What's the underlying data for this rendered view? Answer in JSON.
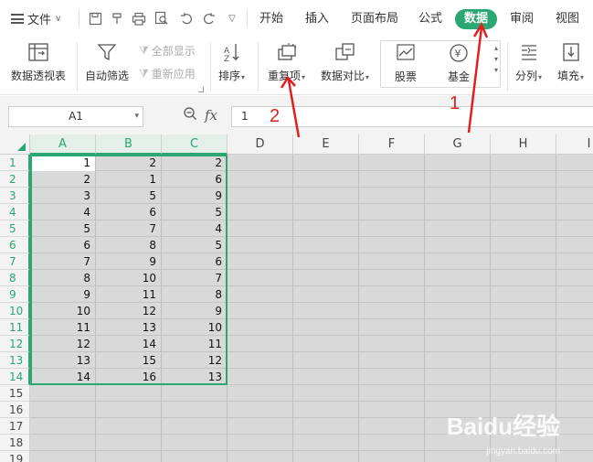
{
  "menu": {
    "file_label": "文件",
    "tabs": [
      "开始",
      "插入",
      "页面布局",
      "公式",
      "数据",
      "审阅",
      "视图"
    ],
    "active_tab": "数据",
    "accent": "#2aa772"
  },
  "ribbon": {
    "pivot": "数据透视表",
    "autofilter": "自动筛选",
    "show_all": "全部显示",
    "reapply": "重新应用",
    "sort": "排序",
    "duplicates": "重复项",
    "compare": "数据对比",
    "stocks": "股票",
    "funds": "基金",
    "split": "分列",
    "fill": "填充"
  },
  "formula_bar": {
    "name_box": "A1",
    "fx": "fx",
    "value": "1"
  },
  "columns": [
    "A",
    "B",
    "C",
    "D",
    "E",
    "F",
    "G",
    "H",
    "I"
  ],
  "rows": [
    "1",
    "2",
    "3",
    "4",
    "5",
    "6",
    "7",
    "8",
    "9",
    "10",
    "11",
    "12",
    "13",
    "14",
    "15",
    "16",
    "17",
    "18",
    "19"
  ],
  "cells": {
    "A": [
      "1",
      "2",
      "3",
      "4",
      "5",
      "6",
      "7",
      "8",
      "9",
      "10",
      "11",
      "12",
      "13",
      "14"
    ],
    "B": [
      "2",
      "1",
      "5",
      "6",
      "7",
      "8",
      "9",
      "10",
      "11",
      "12",
      "13",
      "14",
      "15",
      "16"
    ],
    "C": [
      "2",
      "6",
      "9",
      "5",
      "4",
      "5",
      "6",
      "7",
      "8",
      "9",
      "10",
      "11",
      "12",
      "13"
    ]
  },
  "annotations": {
    "step1": "1",
    "step2": "2"
  },
  "watermark": {
    "brand": "Baidu经验",
    "url": "jingyan.baidu.com"
  }
}
